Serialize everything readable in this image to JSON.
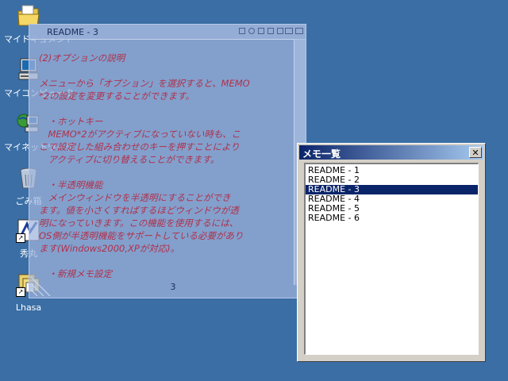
{
  "desktop": {
    "icons": [
      {
        "label": "マイドキュメント",
        "icon": "folder-documents-icon"
      },
      {
        "label": "マイコンピュータ",
        "icon": "computer-icon"
      },
      {
        "label": "マイネットワーク",
        "icon": "network-icon"
      },
      {
        "label": "ごみ箱",
        "icon": "recycle-bin-icon"
      },
      {
        "label": "秀丸",
        "icon": "hidemaru-icon"
      },
      {
        "label": "Lhasa",
        "icon": "lhasa-icon"
      }
    ]
  },
  "memo_window": {
    "title": "README - 3",
    "body": "(2)オプションの説明\n\nメニューから「オプション」を選択すると、MEMO\n*2の設定を変更することができます。\n\n　・ホットキー\n　MEMO*2がアクティブになっていない時も、こ\nこで設定した組み合わせのキーを押すことにより\n　アクティブに切り替えることができます。\n\n　・半透明機能\n　メインウィンドウを半透明にすることができ\nます。値を小さくすればするほどウィンドウが透\n明になっていきます。この機能を使用するには、\nOS側が半透明機能をサポートしている必要があり\nます(Windows2000,XPが対応)。\n\n　・新規メモ設定\n　メモを新規作成したときのデフォルトのフォ\nント、折り返しの設定を変更することができます\n。",
    "status_page": "3"
  },
  "list_window": {
    "title": "メモ一覧",
    "close_label": "✕",
    "items": [
      "README - 1",
      "README - 2",
      "README - 3",
      "README - 4",
      "README - 5",
      "README - 6"
    ],
    "selected_index": 2
  },
  "colors": {
    "desktop_bg": "#3a6ea5",
    "memo_text": "#b0304a",
    "list_selection": "#0a246a"
  }
}
